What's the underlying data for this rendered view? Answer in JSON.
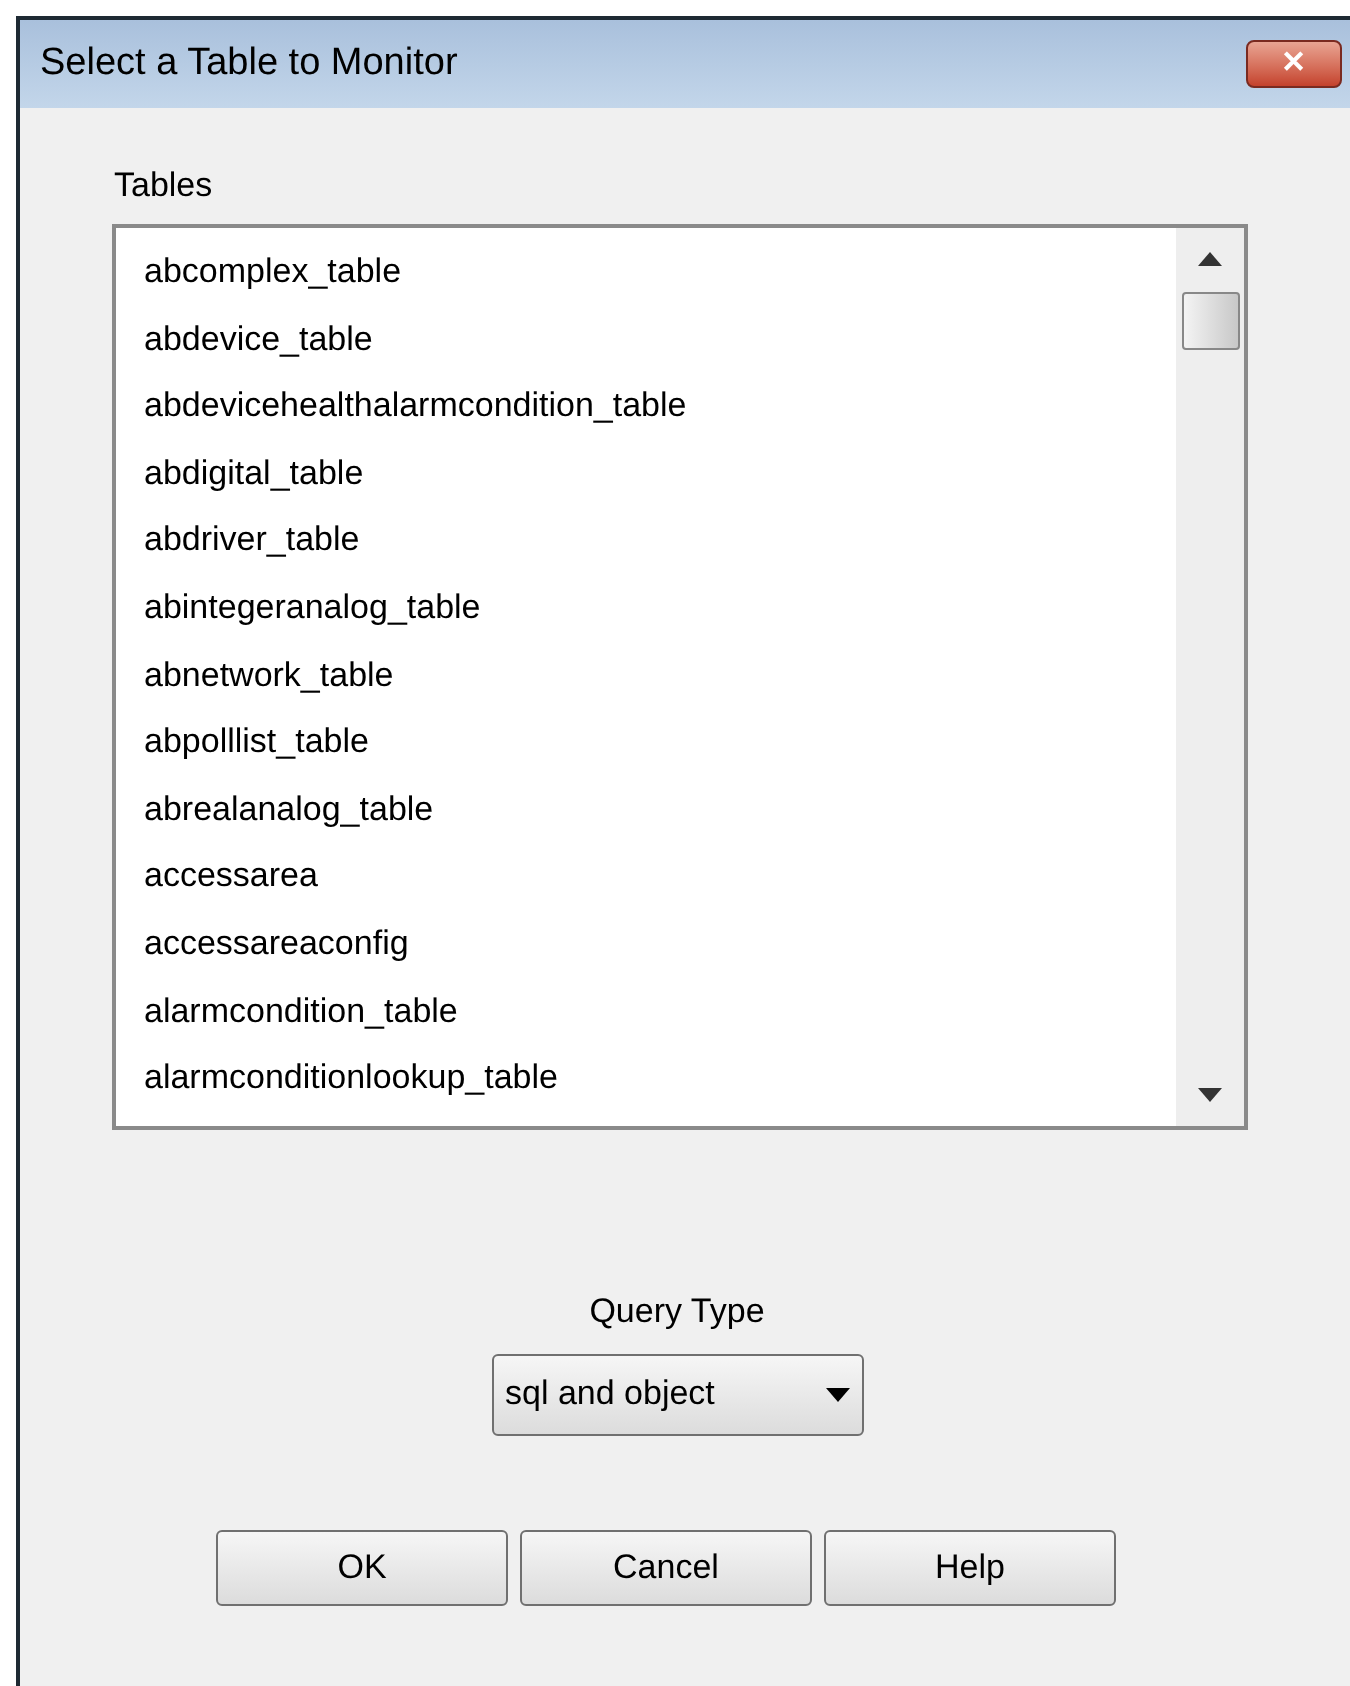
{
  "window": {
    "title": "Select a Table to Monitor",
    "close": "✕"
  },
  "tables": {
    "label": "Tables",
    "items": [
      {
        "name": "abcomplex_table",
        "selected": false
      },
      {
        "name": "abdevice_table",
        "selected": false
      },
      {
        "name": "abdevicehealthalarmcondition_table",
        "selected": false
      },
      {
        "name": "abdigital_table",
        "selected": false
      },
      {
        "name": "abdriver_table",
        "selected": false
      },
      {
        "name": "abintegeranalog_table",
        "selected": false
      },
      {
        "name": "abnetwork_table",
        "selected": false
      },
      {
        "name": "abpolllist_table",
        "selected": false
      },
      {
        "name": "abrealanalog_table",
        "selected": false
      },
      {
        "name": "accessarea",
        "selected": false
      },
      {
        "name": "accessareaconfig",
        "selected": false
      },
      {
        "name": "alarmcondition_table",
        "selected": false
      },
      {
        "name": "alarmconditionlookup_table",
        "selected": false
      }
    ]
  },
  "query_type": {
    "label": "Query Type",
    "value": "sql and object"
  },
  "buttons": [
    "OK",
    "Cancel",
    "Help"
  ]
}
